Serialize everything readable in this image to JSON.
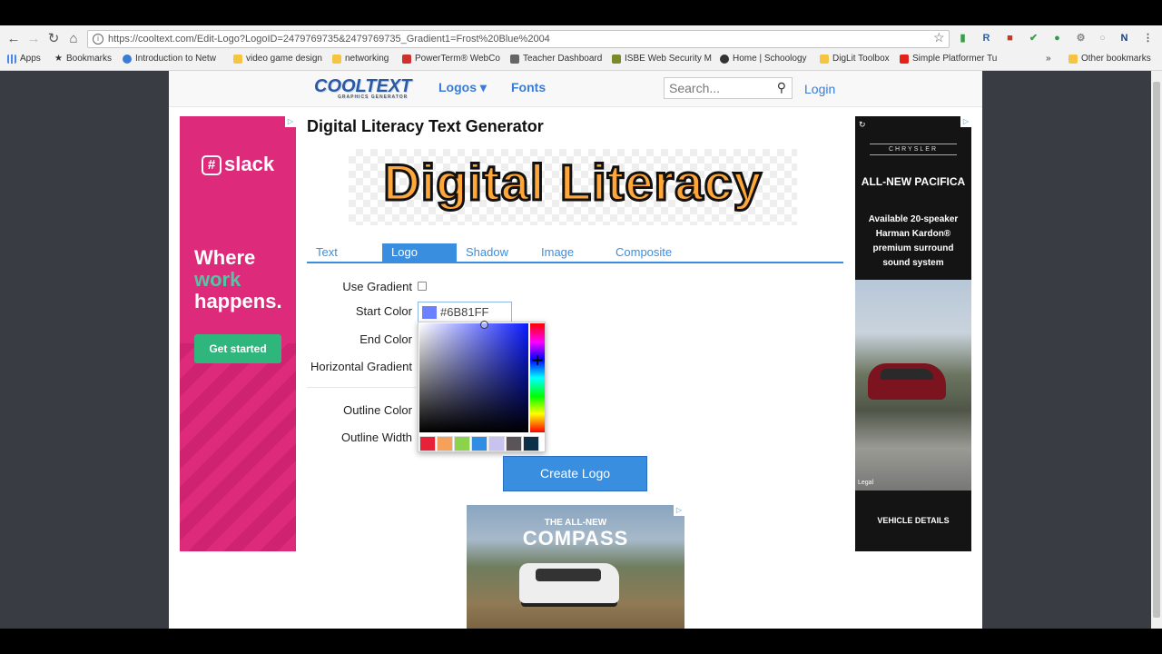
{
  "browser": {
    "url": "https://cooltext.com/Edit-Logo?LogoID=2479769735&2479769735_Gradient1=Frost%20Blue%2004",
    "bookmarks": [
      "Apps",
      "Bookmarks",
      "Introduction to Netw",
      "video game design",
      "networking",
      "PowerTerm® WebCo",
      "Teacher Dashboard",
      "ISBE Web Security M",
      "Home | Schoology",
      "DigLit Toolbox",
      "Simple Platformer Tu"
    ],
    "bookmarks_overflow": "»",
    "other_bookmarks": "Other bookmarks"
  },
  "site": {
    "logo_text": "COOLTEXT",
    "logo_sub": "GRAPHICS GENERATOR",
    "nav_logos": "Logos ▾",
    "nav_fonts": "Fonts",
    "search_placeholder": "Search...",
    "login": "Login"
  },
  "editor": {
    "title": "Digital Literacy Text Generator",
    "preview_text": "Digital Literacy",
    "tabs": [
      "Text",
      "Logo",
      "Shadow",
      "Image",
      "Composite"
    ],
    "active_tab": "Logo",
    "labels": {
      "use_gradient": "Use Gradient",
      "start_color": "Start Color",
      "end_color": "End Color",
      "horizontal_gradient": "Horizontal Gradient",
      "outline_color": "Outline Color",
      "outline_width": "Outline Width"
    },
    "use_gradient_checked": false,
    "start_color_value": "#6B81FF",
    "picker_swatches": [
      "#e8213b",
      "#f5a15a",
      "#8bd34a",
      "#2f8de4",
      "#c7c3ee",
      "#5a5458",
      "#0c2f4a"
    ],
    "create_button": "Create Logo"
  },
  "ads": {
    "slack": {
      "brand": "slack",
      "line1": "Where",
      "line2": "work",
      "line3": "happens.",
      "cta": "Get started"
    },
    "chrysler": {
      "make": "CHRYSLER",
      "headline": "ALL-NEW PACIFICA",
      "body": "Available 20-speaker Harman Kardon® premium surround sound system",
      "legal": "Legal",
      "details": "VEHICLE DETAILS"
    },
    "compass": {
      "line1": "THE ALL-NEW",
      "line2": "COMPASS"
    }
  }
}
